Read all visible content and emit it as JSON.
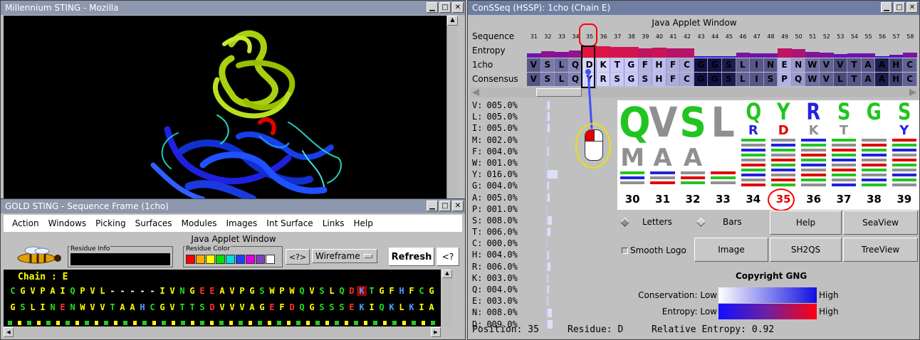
{
  "mozilla": {
    "title": "Millennium STING - Mozilla"
  },
  "gold": {
    "title": "GOLD STING - Sequence Frame (1cho)",
    "menu": [
      "Action",
      "Windows",
      "Picking",
      "Surfaces",
      "Modules",
      "Images",
      "Int Surface",
      "Links",
      "Help"
    ],
    "applet_label": "Java Applet Window",
    "residue_info_label": "Residue Info",
    "residue_color_label": "Residue Color",
    "swatches": [
      "#ff0000",
      "#ffaa00",
      "#ffff00",
      "#00dd00",
      "#00dddd",
      "#2040ff",
      "#dd00dd",
      "#8040c0",
      "#ffffff"
    ],
    "help_q": "<?>",
    "wireframe": "Wireframe",
    "refresh": "Refresh",
    "help_q2": "<?",
    "chain_label": "Chain : E",
    "rows": [
      "CGVPAIQPVL-----IVNGEEAVPGSWPWQVSLQDKTGFHFCG",
      "GSLINENWVVTAAHCGVTTSDVVVAGEFDQGSSSEKIQKLKIA"
    ]
  },
  "conseq": {
    "title": "ConSSeq (HSSP): 1cho (Chain E)",
    "applet_label": "Java Applet Window",
    "labels": {
      "sequence": "Sequence",
      "entropy": "Entropy",
      "pdb": "1cho",
      "consensus": "Consensus"
    },
    "positions": [
      "31",
      "32",
      "33",
      "34",
      "35",
      "36",
      "37",
      "38",
      "39",
      "40",
      "41",
      "42",
      "43",
      "44",
      "45",
      "46",
      "47",
      "48",
      "49",
      "50",
      "51",
      "52",
      "53",
      "54",
      "55",
      "56",
      "57",
      "58"
    ],
    "seq_1cho": [
      "V",
      "S",
      "L",
      "Q",
      "D",
      "K",
      "T",
      "G",
      "F",
      "H",
      "F",
      "C",
      "G",
      "G",
      "S",
      "L",
      "I",
      "N",
      "E",
      "N",
      "W",
      "V",
      "V",
      "T",
      "A",
      "A",
      "H",
      "C"
    ],
    "seq_consensus": [
      "V",
      "S",
      "L",
      "Q",
      "Y",
      "R",
      "S",
      "G",
      "S",
      "H",
      "F",
      "C",
      "G",
      "G",
      "S",
      "L",
      "I",
      "S",
      "P",
      "Q",
      "W",
      "V",
      "L",
      "T",
      "A",
      "A",
      "H",
      "C"
    ],
    "entropy": [
      0.35,
      0.5,
      0.45,
      0.55,
      0.92,
      0.9,
      0.85,
      0.85,
      0.75,
      0.8,
      0.72,
      0.7,
      0.05,
      0.05,
      0.1,
      0.4,
      0.35,
      0.35,
      0.75,
      0.65,
      0.45,
      0.4,
      0.3,
      0.35,
      0.35,
      0.1,
      0.25,
      0.4
    ],
    "freqs": [
      {
        "aa": "V:",
        "pct": "005.0%",
        "v": 0.05
      },
      {
        "aa": "L:",
        "pct": "005.0%",
        "v": 0.05
      },
      {
        "aa": "I:",
        "pct": "005.0%",
        "v": 0.05
      },
      {
        "aa": "M:",
        "pct": "002.0%",
        "v": 0.02
      },
      {
        "aa": "F:",
        "pct": "004.0%",
        "v": 0.04
      },
      {
        "aa": "W:",
        "pct": "001.0%",
        "v": 0.01
      },
      {
        "aa": "Y:",
        "pct": "016.0%",
        "v": 0.16
      },
      {
        "aa": "G:",
        "pct": "004.0%",
        "v": 0.04
      },
      {
        "aa": "A:",
        "pct": "005.0%",
        "v": 0.05
      },
      {
        "aa": "P:",
        "pct": "001.0%",
        "v": 0.01
      },
      {
        "aa": "S:",
        "pct": "008.0%",
        "v": 0.08
      },
      {
        "aa": "T:",
        "pct": "006.0%",
        "v": 0.06
      },
      {
        "aa": "C:",
        "pct": "000.0%",
        "v": 0.0
      },
      {
        "aa": "H:",
        "pct": "004.0%",
        "v": 0.04
      },
      {
        "aa": "R:",
        "pct": "006.0%",
        "v": 0.06
      },
      {
        "aa": "K:",
        "pct": "003.0%",
        "v": 0.03
      },
      {
        "aa": "Q:",
        "pct": "004.0%",
        "v": 0.04
      },
      {
        "aa": "E:",
        "pct": "003.0%",
        "v": 0.03
      },
      {
        "aa": "N:",
        "pct": "008.0%",
        "v": 0.08
      },
      {
        "aa": "D:",
        "pct": "009.0%",
        "v": 0.09
      }
    ],
    "logo_positions": [
      "30",
      "31",
      "32",
      "33",
      "34",
      "35",
      "36",
      "37",
      "38",
      "39"
    ],
    "logo_top": [
      "Q",
      "V",
      "S",
      "L",
      "Q",
      "Y",
      "R",
      "S",
      "G",
      "S"
    ],
    "logo_second": [
      "M",
      "A",
      "A",
      "",
      "R",
      "D",
      "K",
      "T",
      "",
      "Y"
    ],
    "logo_colors": [
      "#22c422",
      "#909090",
      "#22c422",
      "#909090",
      "#22c422",
      "#22c422",
      "#2222dd",
      "#22c422",
      "#22c422",
      "#22c422"
    ],
    "buttons": {
      "letters": "Letters",
      "bars": "Bars",
      "help": "Help",
      "seaview": "SeaView",
      "smooth": "Smooth Logo",
      "image": "Image",
      "sh2qs": "SH2QS",
      "treeview": "TreeView"
    },
    "copyright": "Copyright GNG",
    "conservation_label": "Conservation: Low",
    "entropy_label": "Entropy: Low",
    "high": "High",
    "status": {
      "position": "Position: 35",
      "residue": "Residue: D",
      "entropy": "Relative Entropy: 0.92"
    }
  }
}
